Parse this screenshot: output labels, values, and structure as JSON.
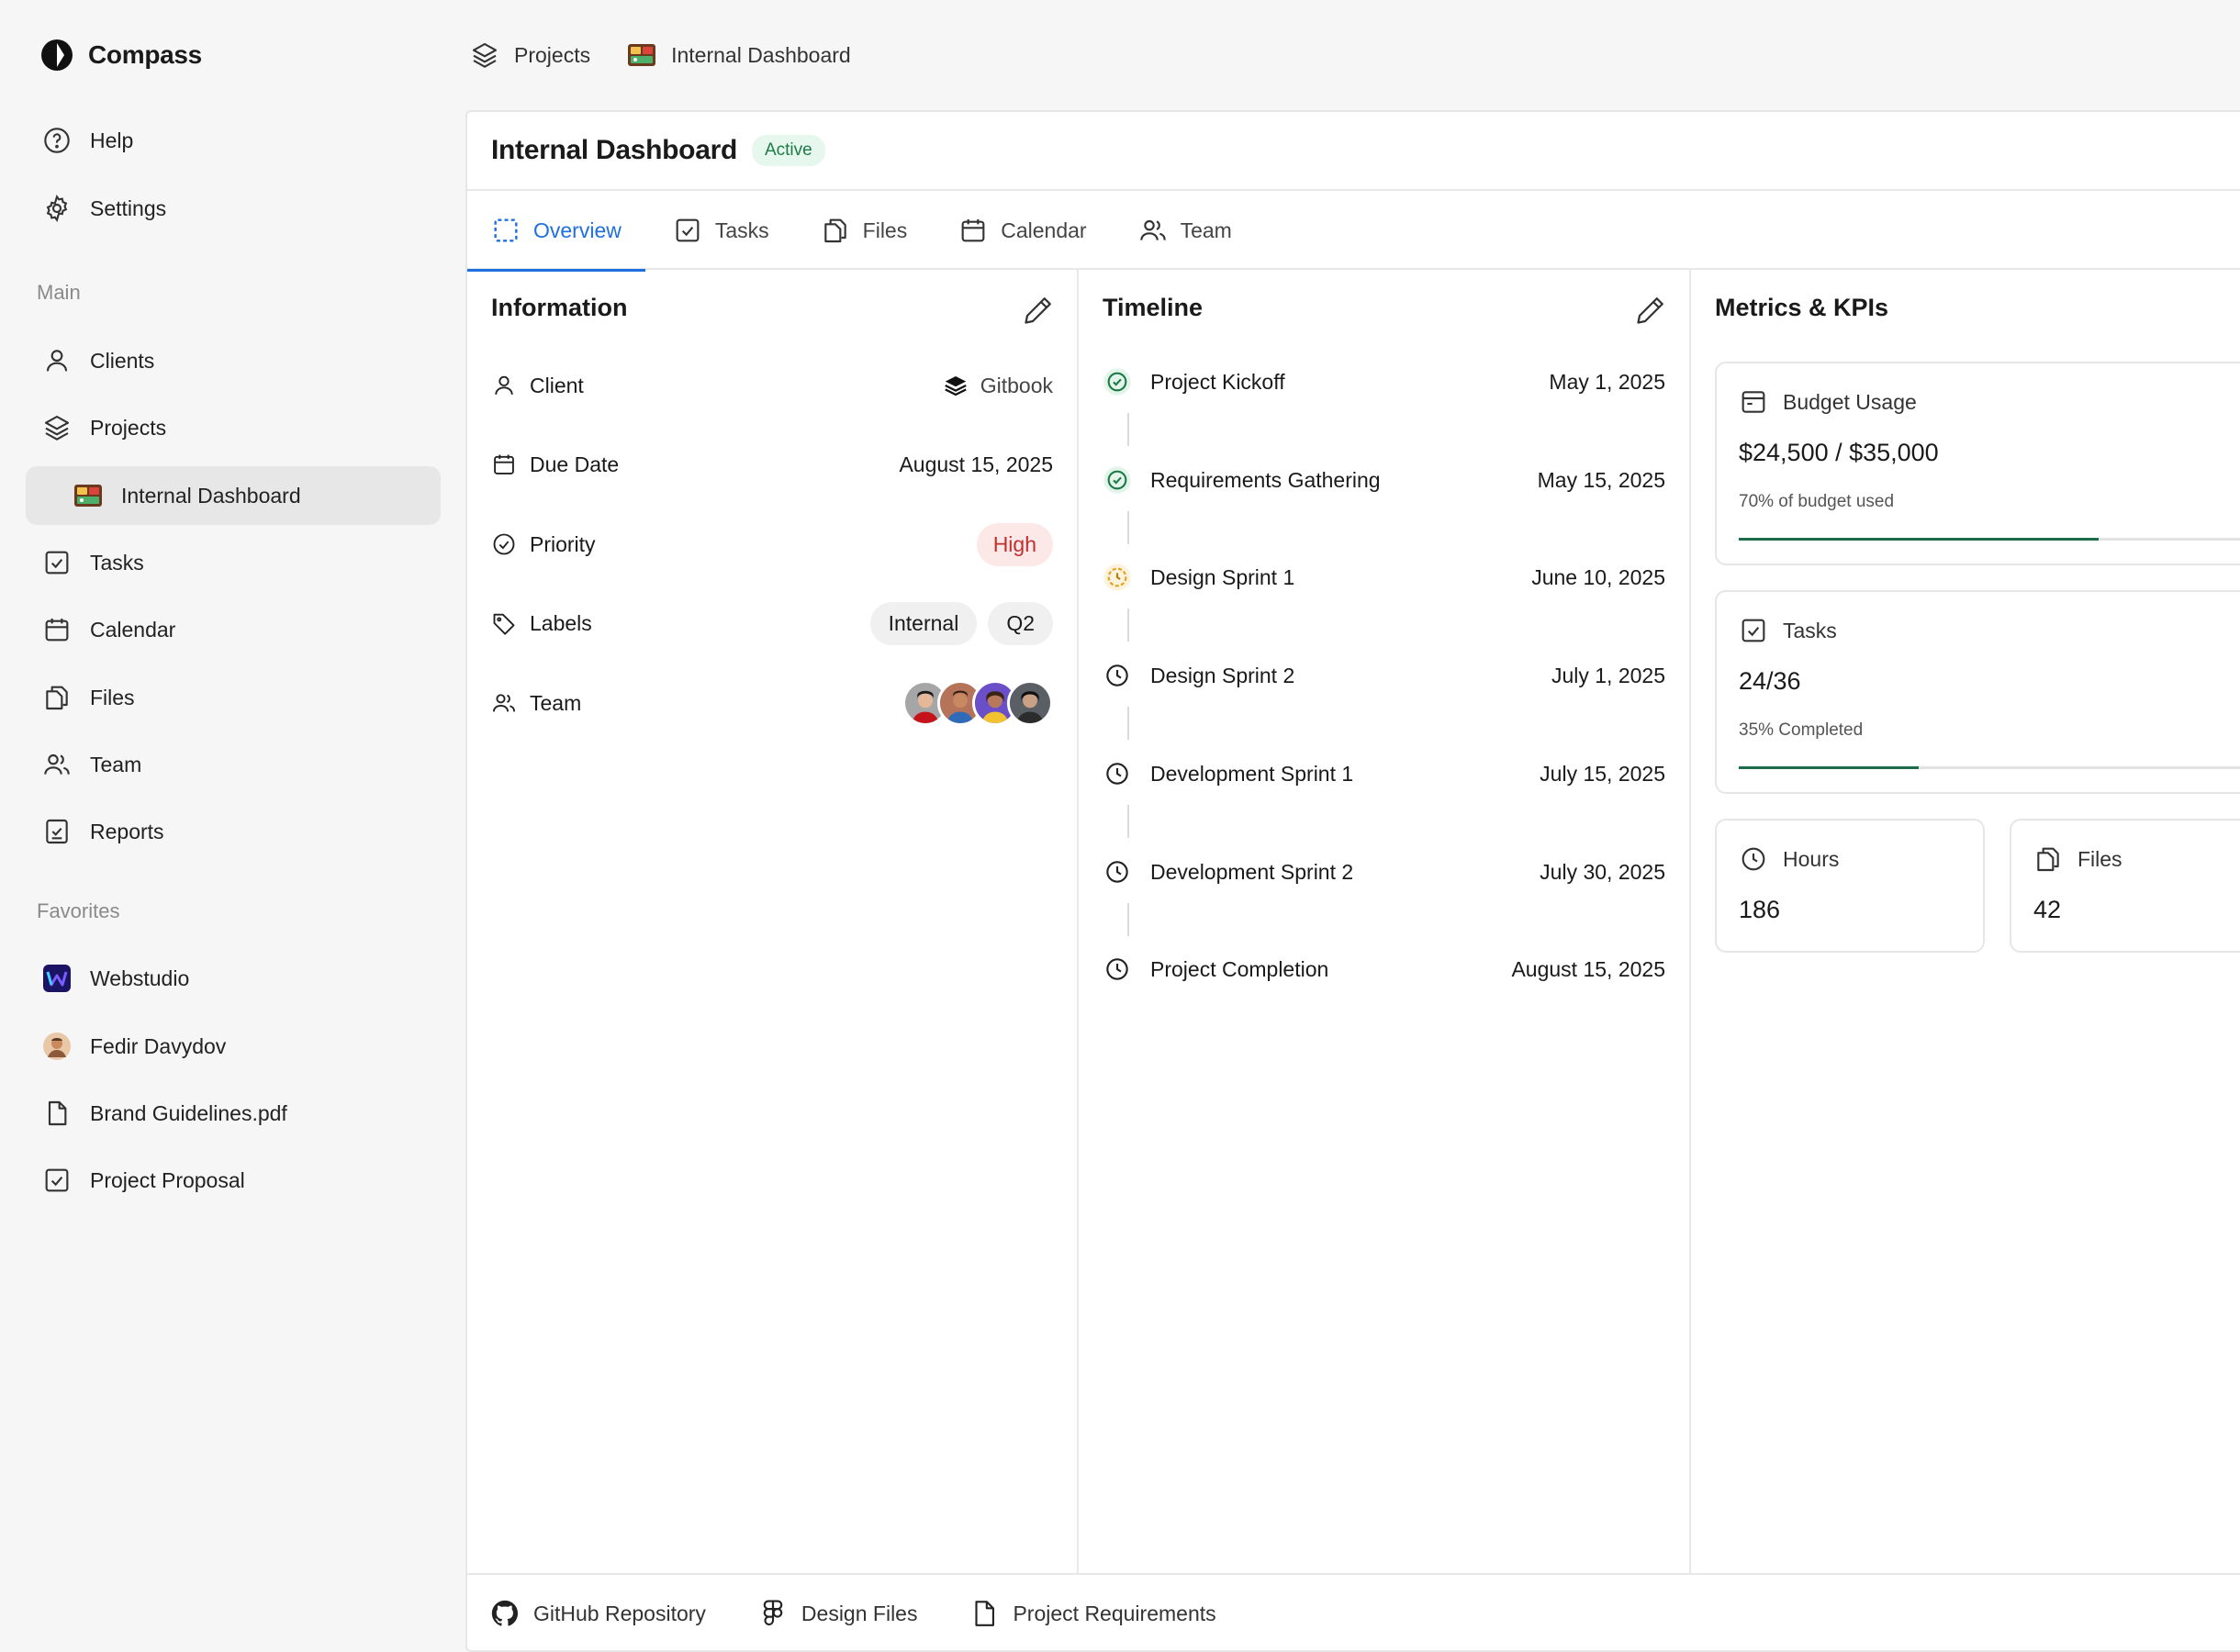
{
  "app": {
    "name": "Compass"
  },
  "sidebar": {
    "top_items": [
      {
        "label": "Help",
        "icon": "help-circle-icon"
      },
      {
        "label": "Settings",
        "icon": "gear-icon"
      }
    ],
    "main_heading": "Main",
    "main_items": [
      {
        "label": "Clients",
        "icon": "user-icon"
      },
      {
        "label": "Projects",
        "icon": "layers-icon"
      },
      {
        "label": "Internal Dashboard",
        "icon": "dashboard-thumbnail-icon",
        "active": true
      },
      {
        "label": "Tasks",
        "icon": "checkbox-icon"
      },
      {
        "label": "Calendar",
        "icon": "calendar-icon"
      },
      {
        "label": "Files",
        "icon": "files-icon"
      },
      {
        "label": "Team",
        "icon": "users-icon"
      },
      {
        "label": "Reports",
        "icon": "report-icon"
      }
    ],
    "favorites_heading": "Favorites",
    "favorites": [
      {
        "label": "Webstudio",
        "icon": "webstudio-logo"
      },
      {
        "label": "Fedir Davydov",
        "icon": "avatar"
      },
      {
        "label": "Brand Guidelines.pdf",
        "icon": "file-icon"
      },
      {
        "label": "Project Proposal",
        "icon": "checkbox-icon"
      }
    ]
  },
  "breadcrumb": [
    {
      "label": "Projects",
      "icon": "layers-icon"
    },
    {
      "label": "Internal Dashboard",
      "icon": "dashboard-thumbnail-icon"
    }
  ],
  "header": {
    "title": "Internal Dashboard",
    "status": "Active"
  },
  "tabs": [
    {
      "label": "Overview",
      "icon": "dashed-square-icon",
      "active": true
    },
    {
      "label": "Tasks",
      "icon": "checkbox-icon"
    },
    {
      "label": "Files",
      "icon": "files-icon"
    },
    {
      "label": "Calendar",
      "icon": "calendar-icon"
    },
    {
      "label": "Team",
      "icon": "users-icon"
    }
  ],
  "information": {
    "title": "Information",
    "client_label": "Client",
    "client_value": "Gitbook",
    "due_label": "Due Date",
    "due_value": "August 15, 2025",
    "priority_label": "Priority",
    "priority_value": "High",
    "labels_label": "Labels",
    "labels": [
      "Internal",
      "Q2"
    ],
    "team_label": "Team"
  },
  "timeline": {
    "title": "Timeline",
    "items": [
      {
        "name": "Project Kickoff",
        "date": "May 1, 2025",
        "status": "done"
      },
      {
        "name": "Requirements Gathering",
        "date": "May 15, 2025",
        "status": "done"
      },
      {
        "name": "Design Sprint 1",
        "date": "June 10, 2025",
        "status": "in-progress"
      },
      {
        "name": "Design Sprint 2",
        "date": "July 1, 2025",
        "status": "pending"
      },
      {
        "name": "Development Sprint 1",
        "date": "July 15, 2025",
        "status": "pending"
      },
      {
        "name": "Development Sprint 2",
        "date": "July 30, 2025",
        "status": "pending"
      },
      {
        "name": "Project Completion",
        "date": "August 15, 2025",
        "status": "pending"
      }
    ]
  },
  "metrics": {
    "title": "Metrics & KPIs",
    "budget": {
      "label": "Budget Usage",
      "value": "$24,500 / $35,000",
      "sub": "70% of budget used",
      "progress": 0.7
    },
    "tasks": {
      "label": "Tasks",
      "value": "24/36",
      "sub": "35% Completed",
      "progress": 0.35
    },
    "hours": {
      "label": "Hours",
      "value": "186"
    },
    "files": {
      "label": "Files",
      "value": "42"
    }
  },
  "footer_links": [
    {
      "label": "GitHub Repository",
      "icon": "github-icon"
    },
    {
      "label": "Design Files",
      "icon": "figma-icon"
    },
    {
      "label": "Project Requirements",
      "icon": "file-icon"
    }
  ],
  "colors": {
    "accent": "#1f6fe0",
    "success": "#1e7a46",
    "danger": "#c0302f",
    "progress": "#1e6b4a",
    "warning": "#e0a21f"
  }
}
